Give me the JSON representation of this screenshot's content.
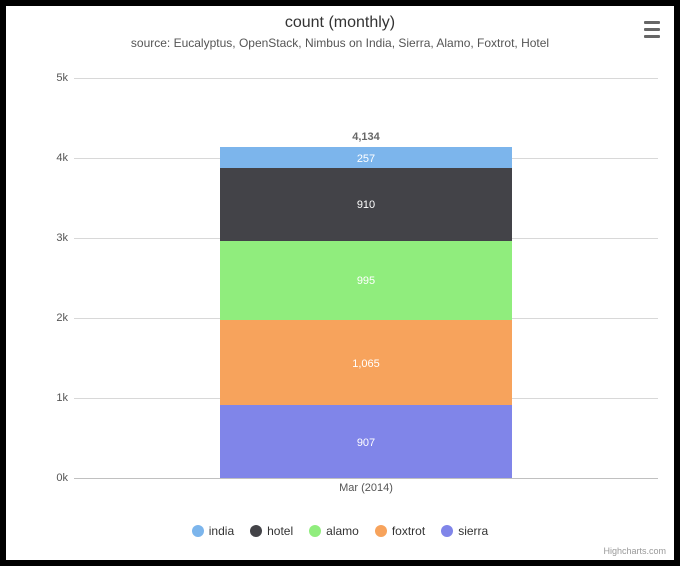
{
  "title": "count (monthly)",
  "subtitle": "source: Eucalyptus, OpenStack, Nimbus on India, Sierra, Alamo, Foxtrot, Hotel",
  "credits": "Highcharts.com",
  "menu_icon": "hamburger-icon",
  "y_ticks": [
    "0k",
    "1k",
    "2k",
    "3k",
    "4k",
    "5k"
  ],
  "x_category": "Mar (2014)",
  "total_label": "4,134",
  "segments": [
    {
      "name": "sierra",
      "label": "907",
      "value": 907,
      "color": "#8085e9",
      "text_color": "#ffffff"
    },
    {
      "name": "foxtrot",
      "label": "1,065",
      "value": 1065,
      "color": "#f7a35c",
      "text_color": "#ffffff"
    },
    {
      "name": "alamo",
      "label": "995",
      "value": 995,
      "color": "#90ed7d",
      "text_color": "#ffffff"
    },
    {
      "name": "hotel",
      "label": "910",
      "value": 910,
      "color": "#434348",
      "text_color": "#ffffff"
    },
    {
      "name": "india",
      "label": "257",
      "value": 257,
      "color": "#7cb5ec",
      "text_color": "#ffffff"
    }
  ],
  "legend": [
    {
      "name": "india",
      "color": "#7cb5ec"
    },
    {
      "name": "hotel",
      "color": "#434348"
    },
    {
      "name": "alamo",
      "color": "#90ed7d"
    },
    {
      "name": "foxtrot",
      "color": "#f7a35c"
    },
    {
      "name": "sierra",
      "color": "#8085e9"
    }
  ],
  "chart_data": {
    "type": "bar",
    "stacked": true,
    "categories": [
      "Mar (2014)"
    ],
    "series": [
      {
        "name": "india",
        "values": [
          257
        ]
      },
      {
        "name": "hotel",
        "values": [
          910
        ]
      },
      {
        "name": "alamo",
        "values": [
          995
        ]
      },
      {
        "name": "foxtrot",
        "values": [
          1065
        ]
      },
      {
        "name": "sierra",
        "values": [
          907
        ]
      }
    ],
    "title": "count (monthly)",
    "subtitle": "source: Eucalyptus, OpenStack, Nimbus on India, Sierra, Alamo, Foxtrot, Hotel",
    "xlabel": "",
    "ylabel": "",
    "ylim": [
      0,
      5000
    ],
    "stack_totals": [
      4134
    ]
  }
}
